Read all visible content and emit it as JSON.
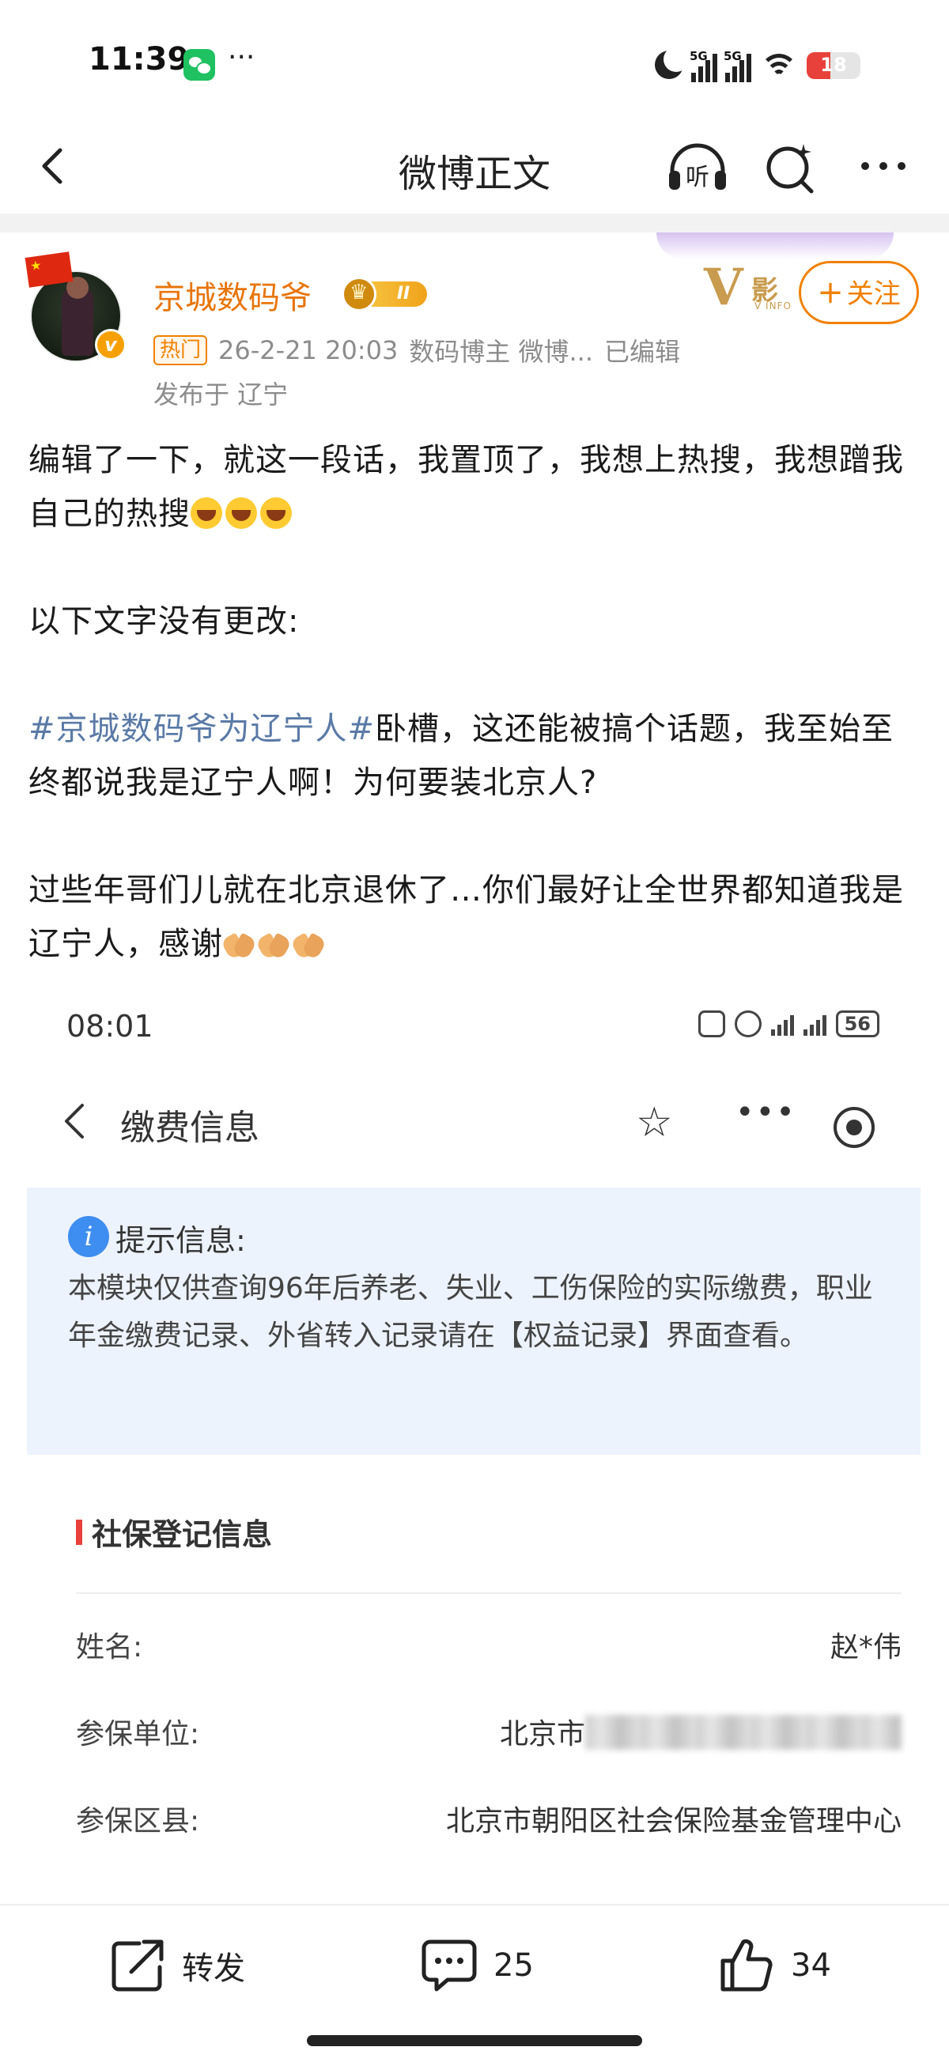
{
  "status_bar": {
    "time": "11:39",
    "more": "···",
    "signal1": "5G",
    "signal2": "5G",
    "battery": "18",
    "battery_level_percent": 18
  },
  "nav": {
    "title": "微博正文",
    "listen_label": "听"
  },
  "author": {
    "name": "京城数码爷",
    "level": "II",
    "vip_logo": "V影",
    "vip_logo_sub": "V INFO",
    "verified_mark": "v",
    "follow_label": "关注",
    "hot_tag": "热门",
    "time": "26-2-21 20:03",
    "role": "数码博主 微博...",
    "edited": "已编辑",
    "location": "发布于 辽宁"
  },
  "post": {
    "p1": "编辑了一下，就这一段话，我置顶了，我想上热搜，我想蹭我自己的热搜",
    "p2": "以下文字没有更改:",
    "topic": "#京城数码爷为辽宁人#",
    "p3_rest": "卧槽，这还能被搞个话题，我至始至终都说我是辽宁人啊！为何要装北京人?",
    "p4": "过些年哥们儿就在北京退休了…你们最好让全世界都知道我是辽宁人，感谢"
  },
  "screenshot": {
    "time": "08:01",
    "battery": "56",
    "title": "缴费信息",
    "tip_title": "提示信息:",
    "tip_body": "本模块仅供查询96年后养老、失业、工伤保险的实际缴费，职业年金缴费记录、外省转入记录请在【权益记录】界面查看。",
    "section_title": "社保登记信息",
    "rows": [
      {
        "label": "姓名:",
        "value": "赵*伟"
      },
      {
        "label": "参保单位:",
        "value": "北京市"
      },
      {
        "label": "参保区县:",
        "value": "北京市朝阳区社会保险基金管理中心"
      }
    ]
  },
  "toolbar": {
    "repost_label": "转发",
    "comment_count": "25",
    "like_count": "34"
  },
  "icons": {
    "back": "chevron-left-icon",
    "listen": "headphones-icon",
    "search": "search-icon",
    "more": "more-icon",
    "repost": "share-icon",
    "comment": "comment-icon",
    "like": "thumbs-up-icon"
  },
  "colors": {
    "accent": "#f08000",
    "author_name": "#e8750c",
    "topic_link": "#5a7aa7",
    "tip_background": "#edf3fd"
  }
}
